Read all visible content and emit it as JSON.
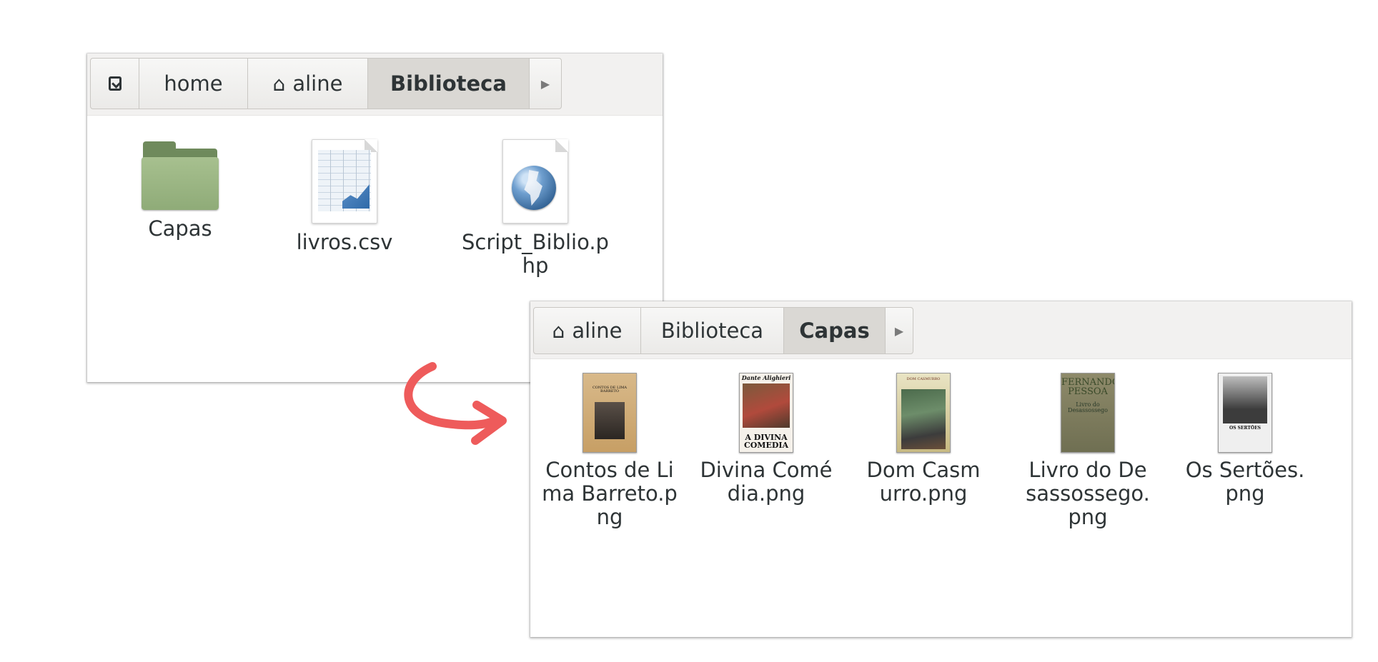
{
  "window1": {
    "pathbar": {
      "segments": [
        "home",
        "aline",
        "Biblioteca"
      ]
    },
    "items": [
      {
        "name": "Capas",
        "icon": "folder-icon"
      },
      {
        "name": "livros.csv",
        "icon": "spreadsheet-icon"
      },
      {
        "name": "Script_Biblio.php",
        "icon": "php-globe-icon"
      }
    ]
  },
  "window2": {
    "pathbar": {
      "segments": [
        "aline",
        "Biblioteca",
        "Capas"
      ]
    },
    "items": [
      {
        "name": "Contos de Lima Barreto.png",
        "cover_title": "CONTOS DE LIMA BARRETO"
      },
      {
        "name": "Divina Comédia.png",
        "cover_author": "Dante Alighieri",
        "cover_title": "A DIVINA COMEDIA"
      },
      {
        "name": "Dom Casmurro.png",
        "cover_title": "DOM CASMURRO"
      },
      {
        "name": "Livro do Desassossego.png",
        "cover_author": "FERNANDO PESSOA",
        "cover_title": "Livro do Desassossego"
      },
      {
        "name": "Os Sertões.png",
        "cover_title": "OS SERTÕES"
      }
    ]
  },
  "colors": {
    "arrow": "#ee5b5b",
    "folder": "#8fab78",
    "active_segment": "#dad8d4"
  }
}
